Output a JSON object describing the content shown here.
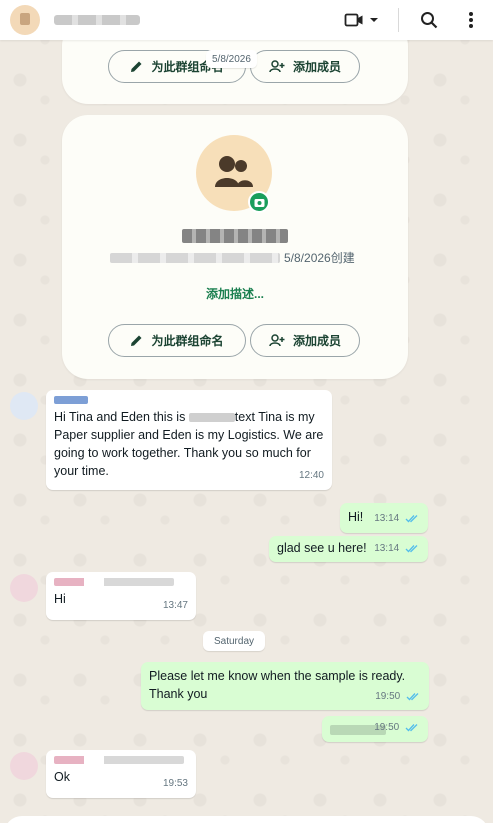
{
  "header": {
    "video_icon": "video-camera-icon",
    "search_icon": "search-icon",
    "menu_icon": "more-vert-icon"
  },
  "top_card": {
    "date_chip": "5/8/2026",
    "rename_label": "为此群组命名",
    "add_member_label": "添加成员"
  },
  "group_card": {
    "created_suffix": "5/8/2026创建",
    "add_description": "添加描述...",
    "rename_label": "为此群组命名",
    "add_member_label": "添加成员"
  },
  "messages": [
    {
      "direction": "in",
      "text_parts": [
        "Hi Tina and Eden this is ",
        "text Tina is my Paper supplier and Eden is my Logistics. We are going to work together. Thank you so much for your time."
      ],
      "time": "12:40"
    },
    {
      "direction": "out",
      "text": "Hi!",
      "time": "13:14"
    },
    {
      "direction": "out",
      "text": "glad see u here!",
      "time": "13:14"
    },
    {
      "direction": "in",
      "text": "Hi",
      "time": "13:47"
    },
    {
      "direction": "out",
      "text": "Please let me know when the sample is ready. Thank you",
      "time": "19:50"
    },
    {
      "direction": "out",
      "text": "",
      "time": "19:50"
    },
    {
      "direction": "in",
      "text": "Ok",
      "time": "19:53"
    }
  ],
  "day_divider": "Saturday",
  "colors": {
    "accent_green": "#1a9e5c",
    "outgoing_bubble": "#d9fdd3",
    "read_tick": "#53bdeb"
  }
}
